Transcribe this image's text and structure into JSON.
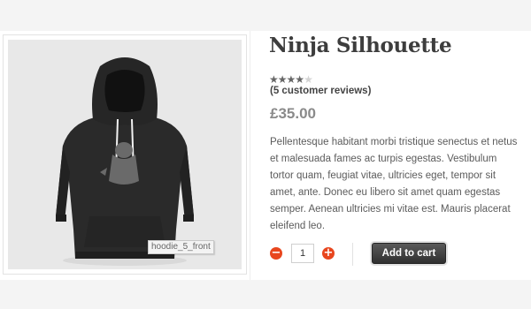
{
  "product": {
    "title": "Ninja Silhouette",
    "rating": 4,
    "rating_max": 5,
    "reviews_text": "(5 customer reviews)",
    "price": "£35.00",
    "description": "Pellentesque habitant morbi tristique senectus et netus et malesuada fames ac turpis egestas. Vestibulum tortor quam, feugiat vitae, ultricies eget, tempor sit amet, ante. Donec eu libero sit amet quam egestas semper. Aenean ultricies mi vitae est. Mauris placerat eleifend leo.",
    "image_caption": "hoodie_5_front"
  },
  "cart": {
    "quantity": "1",
    "minus_symbol": "−",
    "plus_symbol": "+",
    "add_label": "Add to cart"
  },
  "colors": {
    "accent": "#e8461e",
    "button": "#3a3a3a"
  }
}
